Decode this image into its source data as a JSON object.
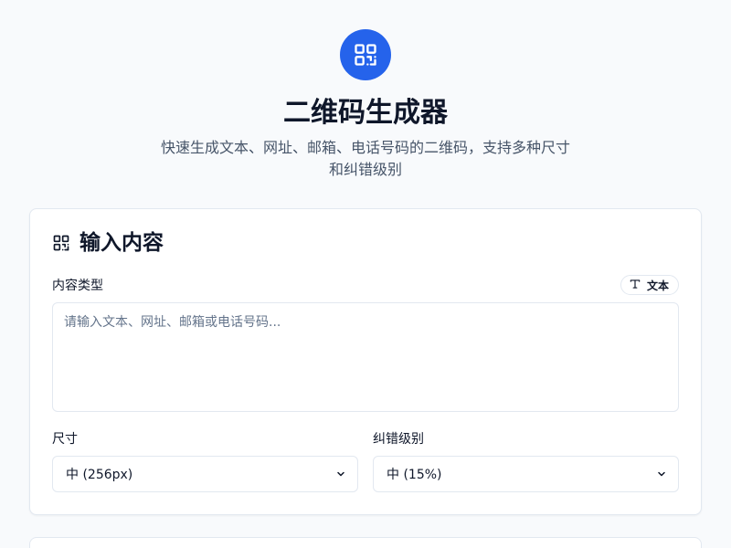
{
  "header": {
    "title": "二维码生成器",
    "subtitle": "快速生成文本、网址、邮箱、电话号码的二维码，支持多种尺寸和纠错级别",
    "logo_icon": "qr-code-icon"
  },
  "input_card": {
    "title": "输入内容",
    "title_icon": "qr-code-icon",
    "content_type_label": "内容类型",
    "content_type_badge": "文本",
    "content_type_icon": "text-type-icon",
    "textarea_placeholder": "请输入文本、网址、邮箱或电话号码...",
    "textarea_value": "",
    "size_label": "尺寸",
    "size_selected": "中 (256px)",
    "ec_label": "纠错级别",
    "ec_selected": "中 (15%)"
  },
  "colors": {
    "accent": "#2563eb",
    "background": "#f8fafc",
    "card": "#ffffff",
    "border": "#e2e8f0",
    "text": "#0f172a",
    "muted": "#475569"
  }
}
